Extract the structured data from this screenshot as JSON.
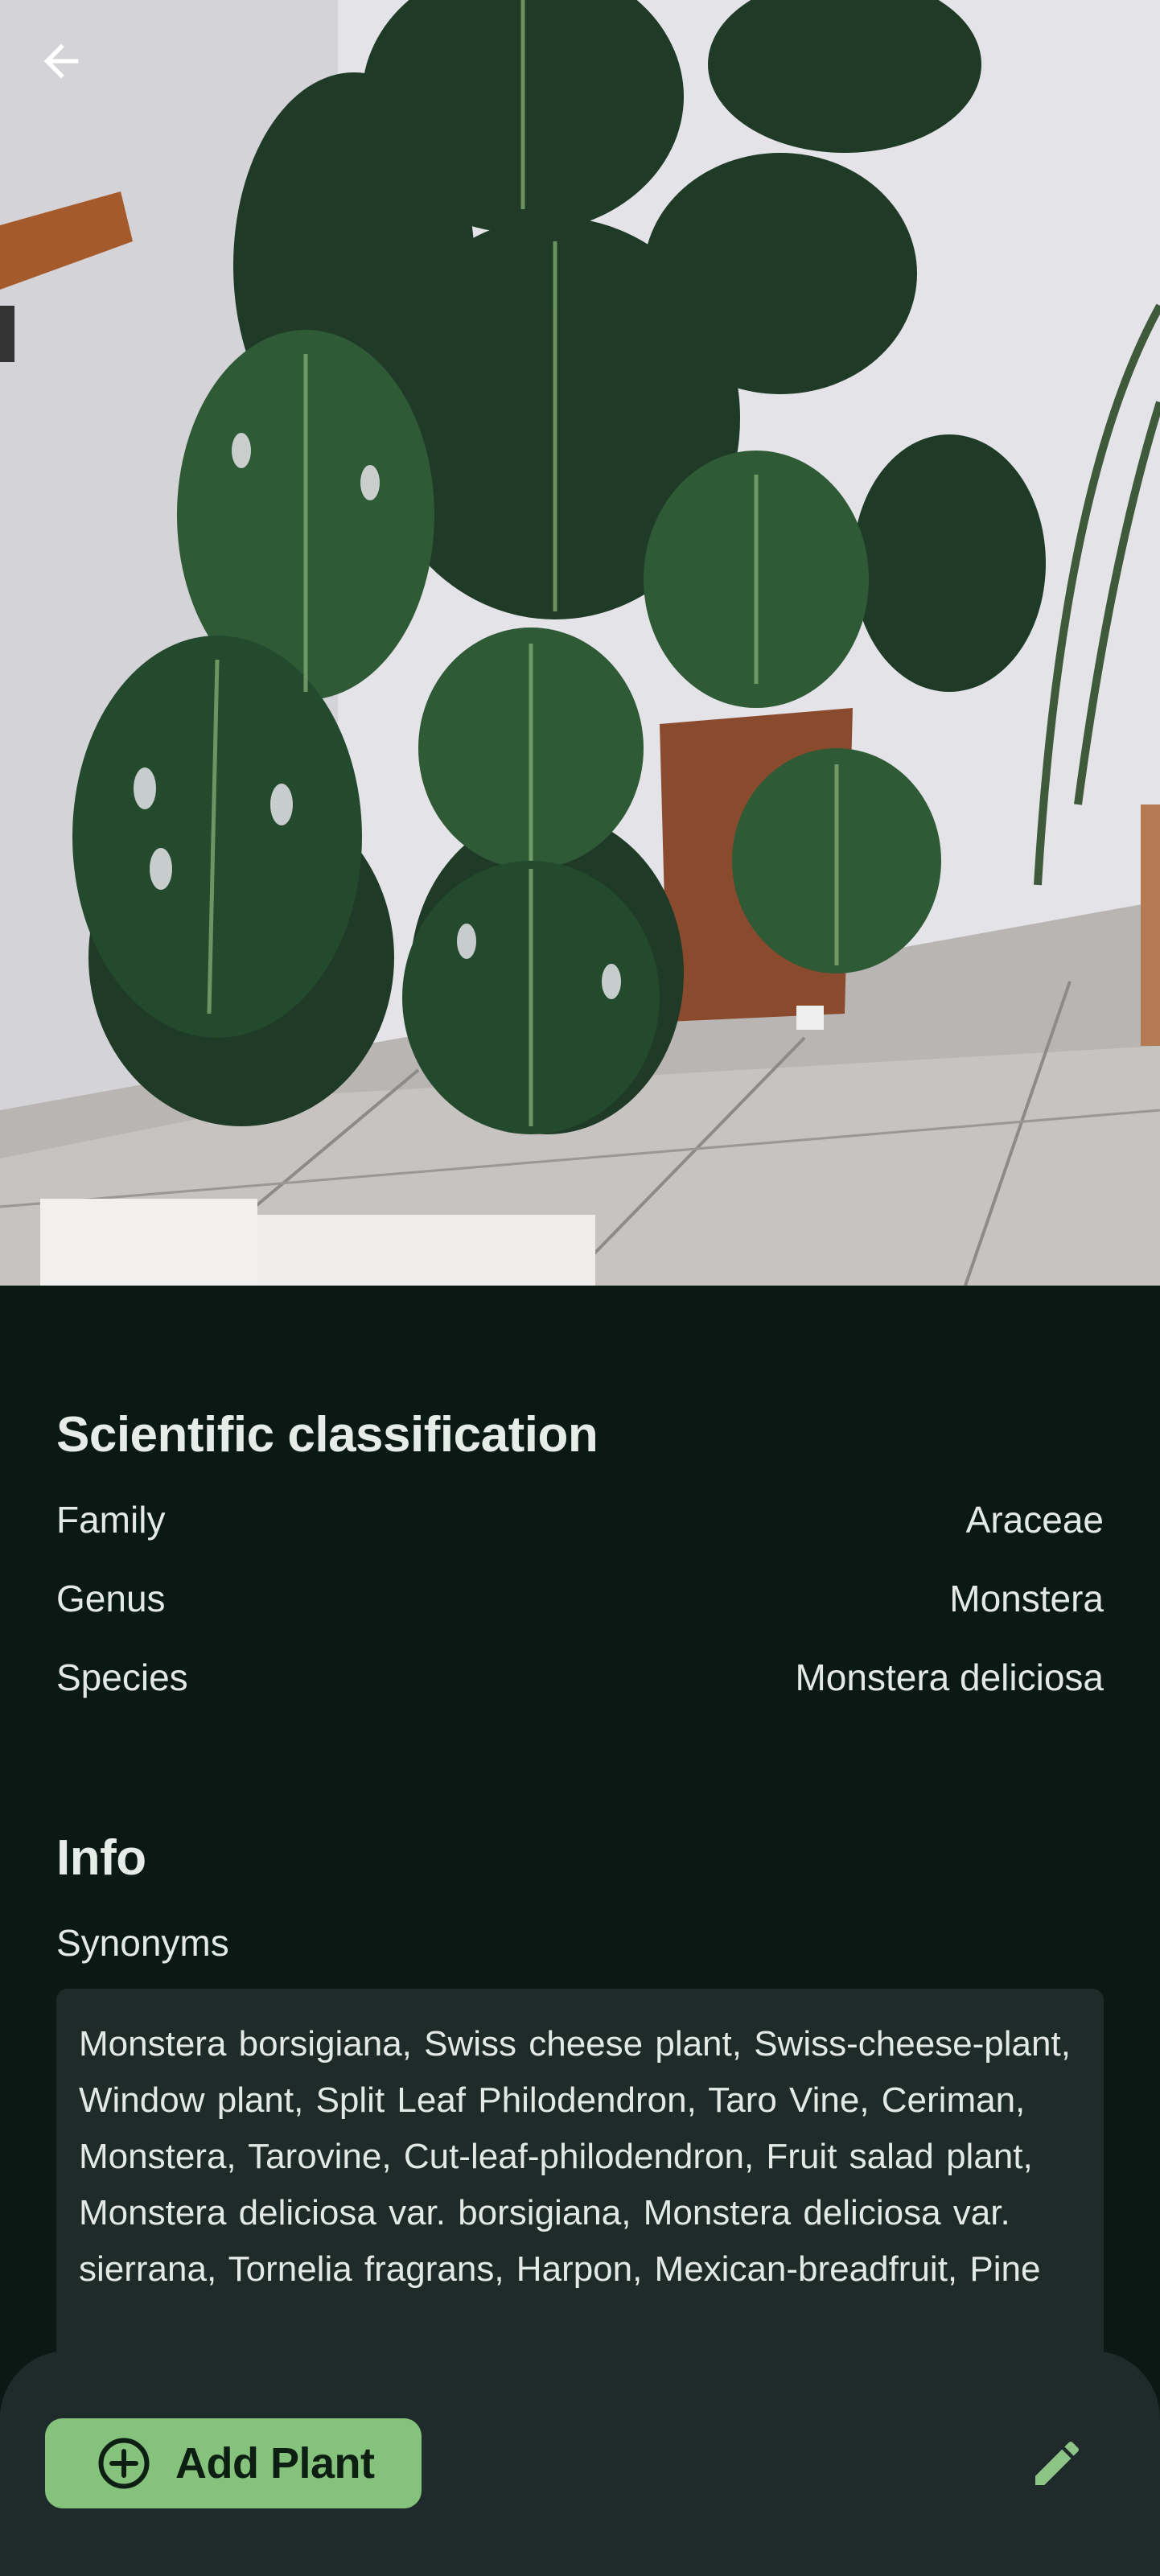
{
  "hero": {
    "image_alt": "Monstera deliciosa plant in a pot on a tiled floor",
    "back_icon": "arrow-back-icon"
  },
  "classification": {
    "title": "Scientific classification",
    "rows": [
      {
        "label": "Family",
        "value": "Araceae"
      },
      {
        "label": "Genus",
        "value": "Monstera"
      },
      {
        "label": "Species",
        "value": "Monstera deliciosa"
      }
    ]
  },
  "info": {
    "title": "Info",
    "synonyms_label": "Synonyms",
    "synonyms_text": " Monstera borsigiana,  Swiss cheese plant,  Swiss-cheese-plant,  Window plant,  Split Leaf Philodendron,  Taro Vine,  Ceriman,  Monstera,  Tarovine,  Cut-leaf-philodendron,  Fruit salad plant,  Monstera deliciosa var. borsigiana,  Monstera deliciosa var. sierrana,  Tornelia fragrans,  Harpon,  Mexican-breadfruit,  Pine"
  },
  "actions": {
    "add_plant_label": "Add Plant",
    "add_icon": "add-circle-icon",
    "edit_icon": "pencil-icon"
  },
  "colors": {
    "background": "#0a1914",
    "surface": "#1f2b28",
    "accent": "#85c27b"
  }
}
